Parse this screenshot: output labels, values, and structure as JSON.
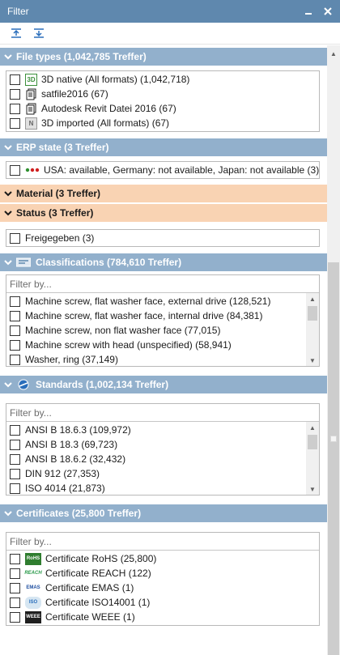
{
  "window": {
    "title": "Filter"
  },
  "toolbar": {},
  "sections": {
    "file_types": {
      "header": "File types (1,042,785 Treffer)",
      "items": [
        {
          "label": "3D native (All formats) (1,042,718)",
          "icon": "3d-native-icon"
        },
        {
          "label": "satfile2016 (67)",
          "icon": "document-icon"
        },
        {
          "label": "Autodesk Revit Datei 2016 (67)",
          "icon": "document-icon"
        },
        {
          "label": "3D imported (All formats) (67)",
          "icon": "3d-imported-icon"
        }
      ]
    },
    "erp_state": {
      "header": "ERP state (3 Treffer)",
      "items": [
        {
          "label": "USA: available, Germany: not available, Japan: not available (3)",
          "icon": "status-dots-icon"
        }
      ]
    },
    "material": {
      "header": "Material (3 Treffer)"
    },
    "status": {
      "header": "Status (3 Treffer)",
      "items": [
        {
          "label": "Freigegeben (3)"
        }
      ]
    },
    "classifications": {
      "header": "Classifications (784,610 Treffer)",
      "filter_placeholder": "Filter by...",
      "items": [
        {
          "label": "Machine screw, flat washer face, external drive (128,521)"
        },
        {
          "label": "Machine screw, flat washer face, internal drive (84,381)"
        },
        {
          "label": "Machine screw, non flat washer face (77,015)"
        },
        {
          "label": "Machine screw with head (unspecified) (58,941)"
        },
        {
          "label": "Washer, ring (37,149)"
        }
      ]
    },
    "standards": {
      "header": "Standards (1,002,134 Treffer)",
      "filter_placeholder": "Filter by...",
      "items": [
        {
          "label": "ANSI B 18.6.3 (109,972)"
        },
        {
          "label": "ANSI B 18.3 (69,723)"
        },
        {
          "label": "ANSI B 18.6.2 (32,432)"
        },
        {
          "label": "DIN 912 (27,353)"
        },
        {
          "label": "ISO 4014 (21,873)"
        }
      ]
    },
    "certificates": {
      "header": "Certificates (25,800 Treffer)",
      "filter_placeholder": "Filter by...",
      "items": [
        {
          "label": "Certificate RoHS (25,800)",
          "icon": "rohs-logo-icon",
          "logo_text": "RoHS"
        },
        {
          "label": "Certificate REACH (122)",
          "icon": "reach-logo-icon",
          "logo_text": "REACH"
        },
        {
          "label": "Certificate EMAS (1)",
          "icon": "emas-logo-icon",
          "logo_text": "EMAS"
        },
        {
          "label": "Certificate ISO14001 (1)",
          "icon": "iso-logo-icon",
          "logo_text": "ISO"
        },
        {
          "label": "Certificate WEEE (1)",
          "icon": "weee-logo-icon",
          "logo_text": "WEEE"
        }
      ]
    }
  },
  "colors": {
    "titlebar": "#5f88ae",
    "section_header": "#92b0cc",
    "section_header_orange": "#f9d3b3"
  }
}
